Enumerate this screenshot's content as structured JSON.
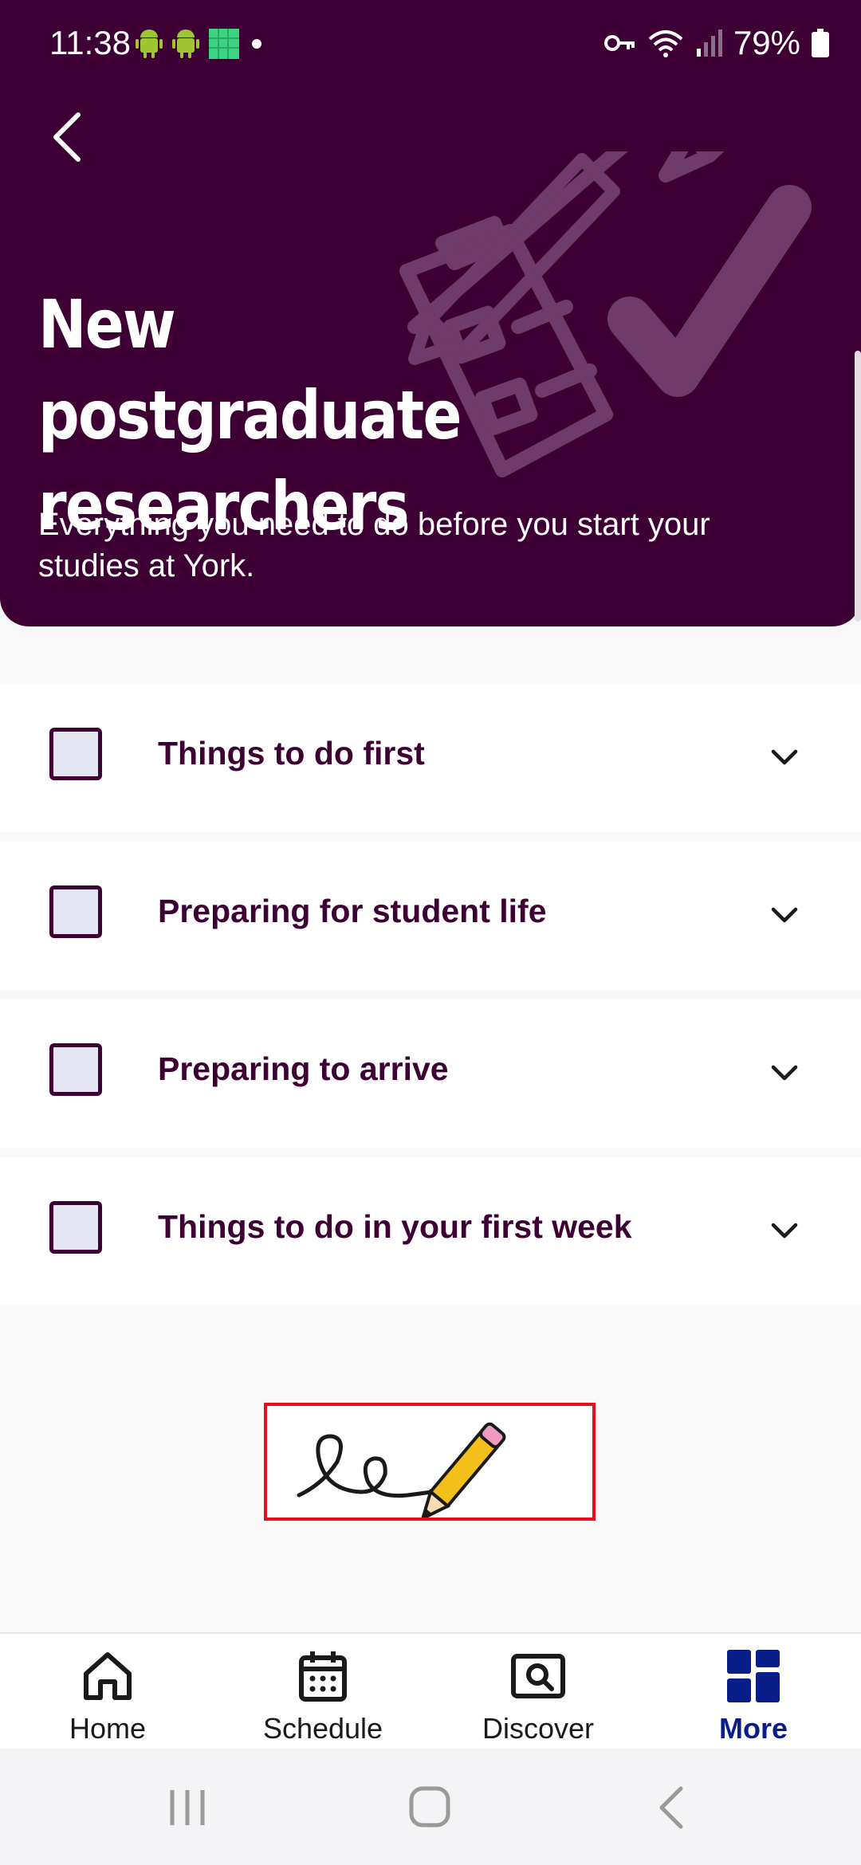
{
  "status_bar": {
    "time": "11:38",
    "battery": "79%"
  },
  "header": {
    "title": "New postgraduate researchers",
    "subtitle": "Everything you need to do before you start your studies at York."
  },
  "checklist": [
    {
      "label": "Things to do first",
      "checked": false
    },
    {
      "label": "Preparing for student life",
      "checked": false
    },
    {
      "label": "Preparing to arrive",
      "checked": false
    },
    {
      "label": "Things to do in your first week",
      "checked": false
    }
  ],
  "bottom_nav": [
    {
      "label": "Home",
      "icon": "home-icon",
      "active": false
    },
    {
      "label": "Schedule",
      "icon": "calendar-icon",
      "active": false
    },
    {
      "label": "Discover",
      "icon": "search-icon",
      "active": false
    },
    {
      "label": "More",
      "icon": "grid-icon",
      "active": true
    }
  ],
  "colors": {
    "primary": "#3e0034",
    "active_nav": "#0a1e8a",
    "checkbox_fill": "#e5e6f3",
    "signature_border": "#e30f1c"
  }
}
